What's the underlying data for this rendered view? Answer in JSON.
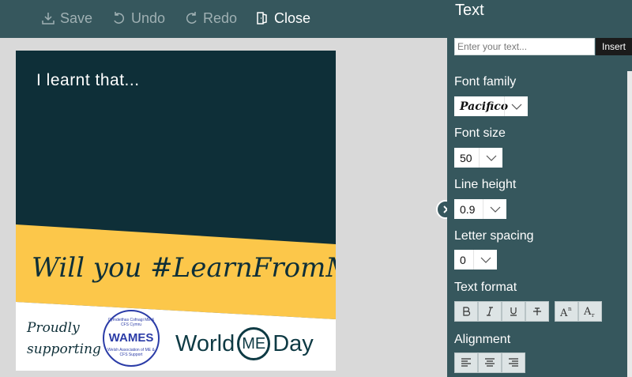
{
  "toolbar": {
    "save_label": "Save",
    "undo_label": "Undo",
    "redo_label": "Redo",
    "close_label": "Close"
  },
  "card": {
    "intro_text": "I learnt that...",
    "headline": "Will you #LearnFromME?",
    "proudly_line1": "Proudly",
    "proudly_line2": "supporting",
    "wames_top": "Cymdeithas Cofnagi ME & CFS Cymru",
    "wames_name": "WAMES",
    "wames_bottom": "Welsh Association of ME & CFS Support",
    "wmd_world": "World",
    "wmd_me": "ME",
    "wmd_day": "Day"
  },
  "panel": {
    "title": "Text",
    "input_placeholder": "Enter your text...",
    "insert_label": "Insert",
    "font_family_label": "Font family",
    "font_family_value": "Pacifico",
    "font_size_label": "Font size",
    "font_size_value": "50",
    "line_height_label": "Line height",
    "line_height_value": "0.9",
    "letter_spacing_label": "Letter spacing",
    "letter_spacing_value": "0",
    "text_format_label": "Text format",
    "alignment_label": "Alignment"
  },
  "colors": {
    "toolbar_bg": "#36575d",
    "card_dark": "#0e2f38",
    "card_yellow": "#fcc74a",
    "wames_blue": "#2b3ca7"
  }
}
